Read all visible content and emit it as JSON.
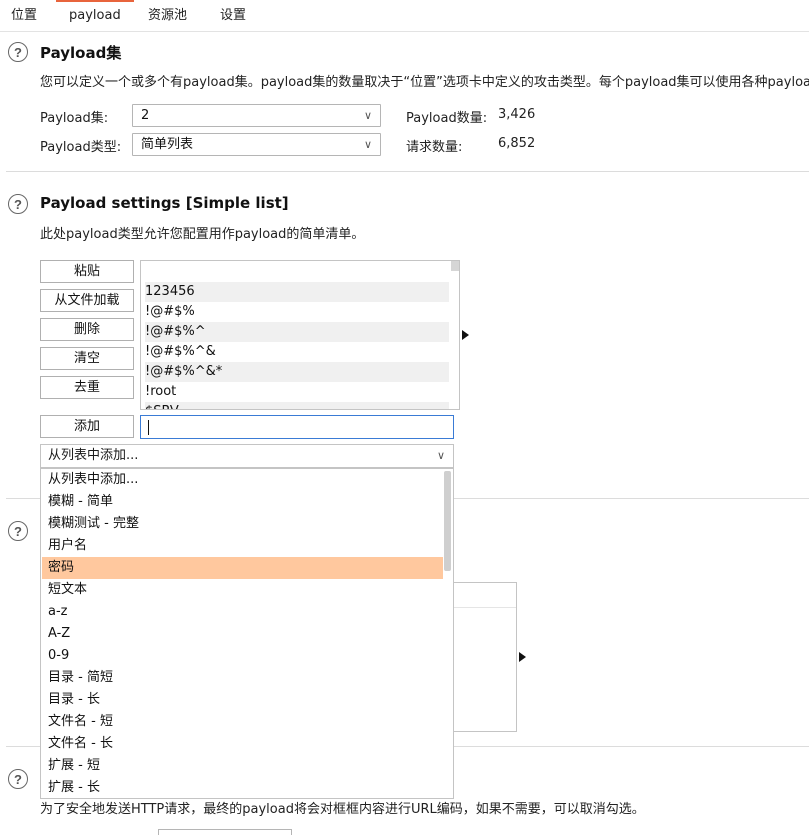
{
  "tabs": [
    "位置",
    "payload",
    "资源池",
    "设置"
  ],
  "payload_sets": {
    "title": "Payload集",
    "description": "您可以定义一个或多个有payload集。payload集的数量取决于“位置”选项卡中定义的攻击类型。每个payload集可以使用各种payload 类",
    "set_label": "Payload集:",
    "set_value": "2",
    "type_label": "Payload类型:",
    "type_value": "简单列表",
    "count_label": "Payload数量:",
    "count_value": "3,426",
    "requests_label": "请求数量:",
    "requests_value": "6,852"
  },
  "payload_settings": {
    "title": "Payload settings [Simple list]",
    "description": "此处payload类型允许您配置用作payload的简单清单。",
    "buttons": {
      "paste": "粘贴",
      "load": "从文件加载",
      "remove": "删除",
      "clear": "清空",
      "dedupe": "去重",
      "add": "添加"
    },
    "list_items": [
      "123456",
      "!@#$%",
      "!@#$%^",
      "!@#$%^&",
      "!@#$%^&*",
      "!root",
      "$SRV"
    ],
    "add_input_value": "",
    "add_from_list_placeholder": "从列表中添加..."
  },
  "dropdown": {
    "options": [
      "从列表中添加...",
      "模糊 - 简单",
      "模糊测试 - 完整",
      "用户名",
      "密码",
      "短文本",
      "a-z",
      "A-Z",
      "0-9",
      "目录 - 简短",
      "目录 - 长",
      "文件名 - 短",
      "文件名 - 长",
      "扩展 - 短",
      "扩展 - 长"
    ],
    "selected": "密码"
  },
  "encoding": {
    "description": "为了安全地发送HTTP请求，最终的payload将会对框框内容进行URL编码，如果不需要，可以取消勾选。"
  },
  "colors": {
    "accent": "#e8643c",
    "selection": "#ffc89e",
    "focus": "#3a7bd5"
  },
  "icons": {
    "help": "help-circle-icon",
    "chevron": "chevron-down-icon",
    "expand": "triangle-right-icon"
  }
}
